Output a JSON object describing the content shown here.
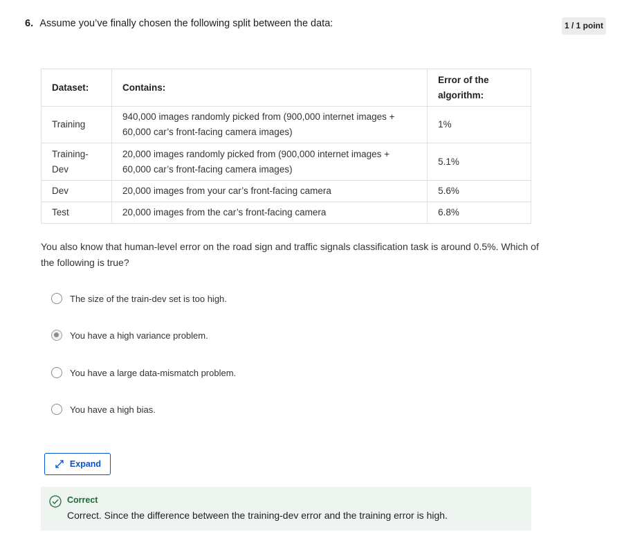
{
  "question": {
    "number": "6.",
    "text": "Assume you’ve finally chosen the following split between the data:",
    "points": "1 / 1 point"
  },
  "table": {
    "headers": [
      "Dataset:",
      "Contains:",
      "Error of the algorithm:"
    ],
    "rows": [
      {
        "dataset": "Training",
        "contains": "940,000 images randomly picked from (900,000 internet images + 60,000 car’s front-facing camera images)",
        "error": "1%"
      },
      {
        "dataset": "Training-Dev",
        "contains": "20,000 images randomly picked from (900,000 internet images + 60,000 car’s front-facing camera images)",
        "error": "5.1%"
      },
      {
        "dataset": "Dev",
        "contains": "20,000 images from your car’s front-facing camera",
        "error": "5.6%"
      },
      {
        "dataset": "Test",
        "contains": "20,000 images from the car’s front-facing camera",
        "error": "6.8%"
      }
    ]
  },
  "prompt": "You also know that human-level error on the road sign and traffic signals classification task is around 0.5%. Which of the following is true?",
  "options": [
    {
      "label": "The size of the train-dev set is too high.",
      "selected": false
    },
    {
      "label": "You have a high variance problem.",
      "selected": true
    },
    {
      "label": "You have a large data-mismatch problem.",
      "selected": false
    },
    {
      "label": "You have a high bias.",
      "selected": false
    }
  ],
  "expand_label": "Expand",
  "feedback": {
    "title": "Correct",
    "text": "Correct. Since the difference between the training-dev error and the training error is high."
  },
  "colors": {
    "accent": "#0056d2",
    "success": "#1d6b36",
    "feedback_bg": "#eef5f0"
  }
}
